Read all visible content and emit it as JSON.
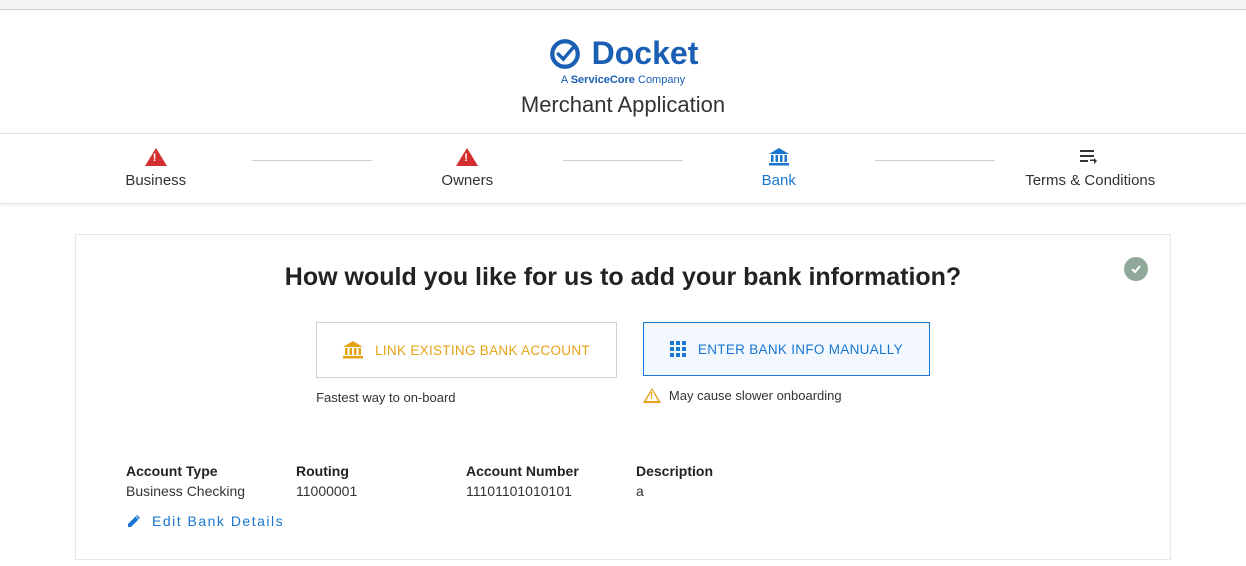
{
  "header": {
    "brand": "Docket",
    "tagline_prefix": "A ",
    "tagline_bold": "ServiceCore",
    "tagline_suffix": " Company",
    "app_title": "Merchant Application"
  },
  "tabs": {
    "business": "Business",
    "owners": "Owners",
    "bank": "Bank",
    "terms": "Terms & Conditions"
  },
  "card": {
    "title": "How would you like for us to add your bank information?",
    "link_button": "LINK EXISTING BANK ACCOUNT",
    "link_hint": "Fastest way to on-board",
    "manual_button": "ENTER BANK INFO MANUALLY",
    "manual_hint": "May cause slower onboarding"
  },
  "details": {
    "account_type_label": "Account Type",
    "account_type_value": "Business Checking",
    "routing_label": "Routing",
    "routing_value": "11000001",
    "account_number_label": "Account Number",
    "account_number_value": "11101101010101",
    "description_label": "Description",
    "description_value": "a",
    "edit_link": "Edit Bank Details"
  }
}
